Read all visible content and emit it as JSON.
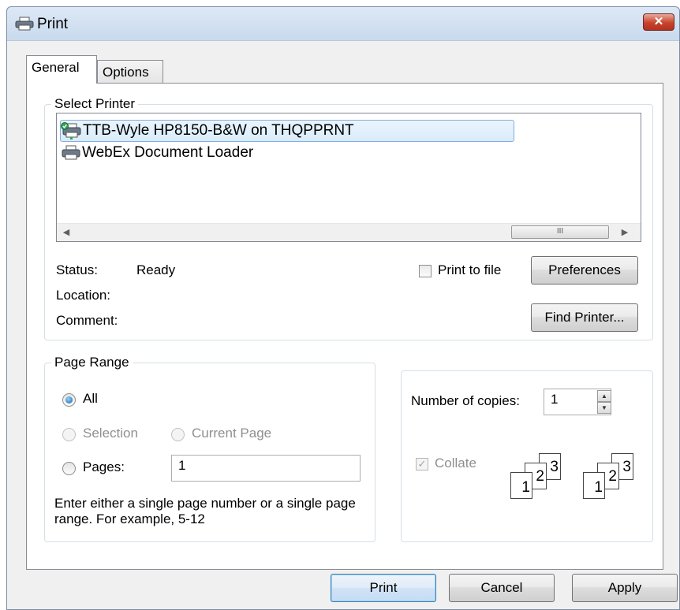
{
  "window": {
    "title": "Print",
    "close_glyph": "✕"
  },
  "tabs": [
    {
      "label": "General"
    },
    {
      "label": "Options"
    }
  ],
  "select_printer": {
    "legend": "Select Printer",
    "printers": [
      {
        "name": "TTB-Wyle HP8150-B&W on THQPPRNT",
        "icon": "network-printer-default-icon",
        "selected": true
      },
      {
        "name": "WebEx Document Loader",
        "icon": "printer-icon",
        "selected": false
      }
    ],
    "scroll_thumb_glyph": "III",
    "status_label": "Status:",
    "status_value": "Ready",
    "location_label": "Location:",
    "comment_label": "Comment:",
    "print_to_file_label": "Print to file",
    "preferences_label": "Preferences",
    "find_printer_label": "Find Printer..."
  },
  "page_range": {
    "legend": "Page Range",
    "all_label": "All",
    "selection_label": "Selection",
    "current_page_label": "Current Page",
    "pages_label": "Pages:",
    "pages_value": "1",
    "hint": "Enter either a single page number or a single page range.  For example, 5-12"
  },
  "copies": {
    "number_label": "Number of copies:",
    "number_value": "1",
    "collate_label": "Collate",
    "page_numbers": [
      "1",
      "2",
      "3"
    ]
  },
  "buttons": {
    "print": "Print",
    "cancel": "Cancel",
    "apply": "Apply"
  },
  "colors": {
    "title_bar": "#c9daee",
    "selection": "#d9ecfb",
    "close_button": "#c7432c"
  }
}
